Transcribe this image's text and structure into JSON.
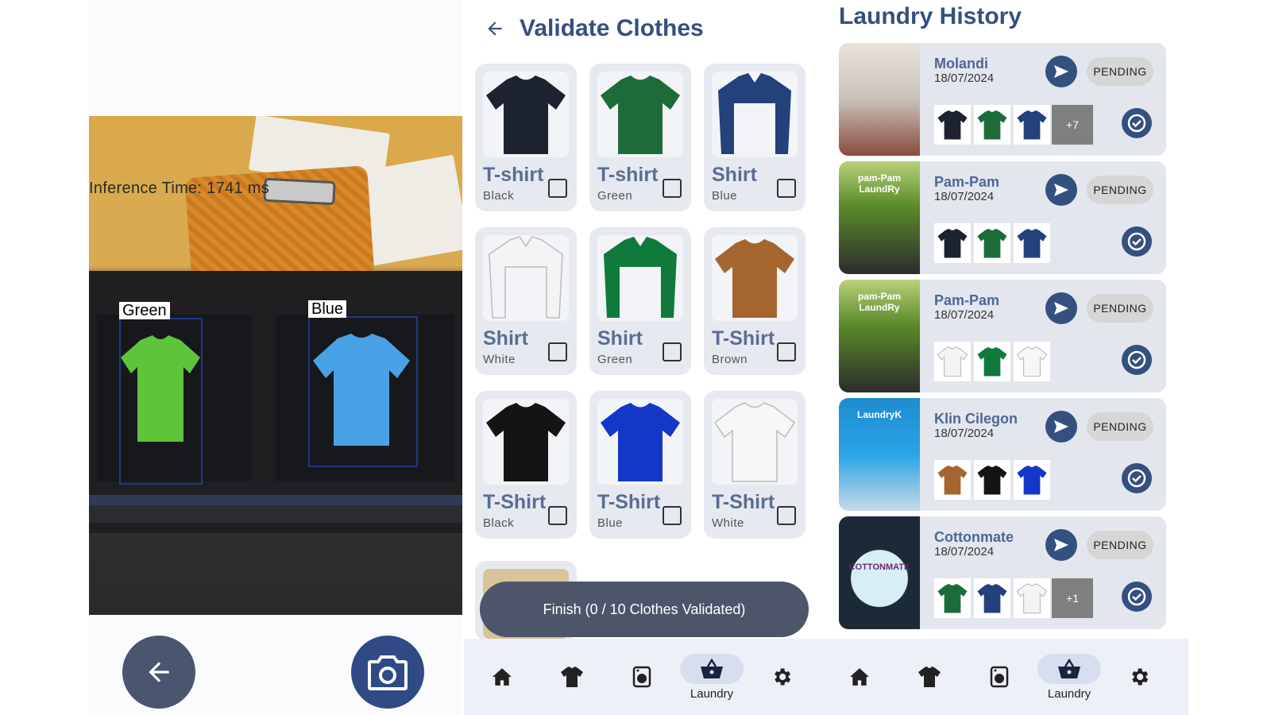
{
  "camera": {
    "inference_text": "Inference Time: 1741 ms",
    "detections": [
      {
        "label": "Green"
      },
      {
        "label": "Blue"
      }
    ],
    "icons": {
      "back": "arrow-left-icon",
      "shutter": "camera-icon"
    }
  },
  "validate": {
    "title": "Validate Clothes",
    "items": [
      {
        "name": "T-shirt",
        "color": "Black",
        "swatch": "#1d2230",
        "kind": "tshirt"
      },
      {
        "name": "T-shirt",
        "color": "Green",
        "swatch": "#1e6b3a",
        "kind": "tshirt"
      },
      {
        "name": "Shirt",
        "color": "Blue",
        "swatch": "#23417a",
        "kind": "shirt"
      },
      {
        "name": "Shirt",
        "color": "White",
        "swatch": "#f4f4f6",
        "kind": "shirt"
      },
      {
        "name": "Shirt",
        "color": "Green",
        "swatch": "#0f7a3c",
        "kind": "shirt"
      },
      {
        "name": "T-Shirt",
        "color": "Brown",
        "swatch": "#a4652e",
        "kind": "tshirt"
      },
      {
        "name": "T-Shirt",
        "color": "Black",
        "swatch": "#141414",
        "kind": "tshirt"
      },
      {
        "name": "T-Shirt",
        "color": "Blue",
        "swatch": "#1437c8",
        "kind": "tshirt"
      },
      {
        "name": "T-Shirt",
        "color": "White",
        "swatch": "#f7f7f7",
        "kind": "tshirt"
      }
    ],
    "finish_label": "Finish (0 / 10 Clothes Validated)"
  },
  "nav": {
    "items": [
      {
        "icon": "home-icon"
      },
      {
        "icon": "shirt-icon"
      },
      {
        "icon": "washing-machine-icon"
      },
      {
        "icon": "basket-icon",
        "label": "Laundry",
        "active": true
      },
      {
        "icon": "gear-icon"
      }
    ]
  },
  "history": {
    "title": "Laundry History",
    "orders": [
      {
        "store": "Molandi",
        "date": "18/07/2024",
        "status": "PENDING",
        "thumbs": [
          "#1d2230",
          "#1e6b3a",
          "#23417a"
        ],
        "more": "+7"
      },
      {
        "store": "Pam-Pam",
        "date": "18/07/2024",
        "status": "PENDING",
        "thumbs": [
          "#1d2230",
          "#1e6b3a",
          "#23417a"
        ],
        "more": ""
      },
      {
        "store": "Pam-Pam",
        "date": "18/07/2024",
        "status": "PENDING",
        "thumbs": [
          "#f4f4f6",
          "#0f7a3c",
          "#f7f7f7"
        ],
        "more": ""
      },
      {
        "store": "Klin Cilegon",
        "date": "18/07/2024",
        "status": "PENDING",
        "thumbs": [
          "#a4652e",
          "#141414",
          "#1437c8"
        ],
        "more": ""
      },
      {
        "store": "Cottonmate",
        "date": "18/07/2024",
        "status": "PENDING",
        "thumbs": [
          "#1e6b3a",
          "#23417a",
          "#f4f4f6"
        ],
        "more": "+1"
      }
    ],
    "store_signs": [
      "",
      "pam-Pam LaundRy",
      "pam-Pam LaundRy",
      "LaundryK",
      "COTTONMATE"
    ]
  },
  "colors": {
    "accent": "#34507f",
    "card": "#e7e9f1",
    "nav_bg": "#eef0f7"
  }
}
